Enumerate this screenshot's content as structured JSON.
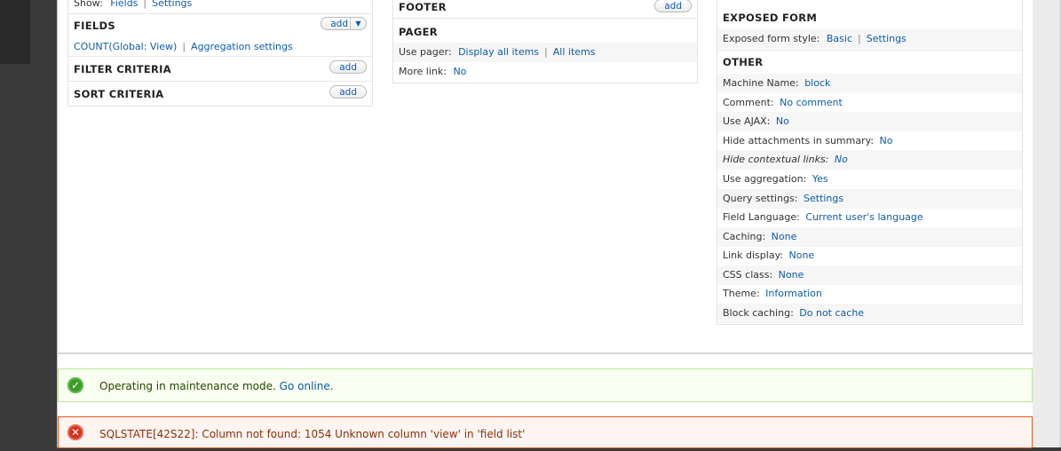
{
  "left": {
    "show_label": "Show:",
    "show_fields": "Fields",
    "show_settings": "Settings",
    "fields_heading": "FIELDS",
    "fields_add": "add",
    "field_item": "COUNT(Global: View)",
    "aggregation_settings": "Aggregation settings",
    "filter_heading": "FILTER CRITERIA",
    "filter_add": "add",
    "sort_heading": "SORT CRITERIA",
    "sort_add": "add"
  },
  "middle": {
    "footer_heading": "FOOTER",
    "footer_add": "add",
    "pager_heading": "PAGER",
    "use_pager_label": "Use pager:",
    "use_pager_value": "Display all items",
    "use_pager_extra": "All items",
    "more_link_label": "More link:",
    "more_link_value": "No"
  },
  "right": {
    "exposed_heading": "EXPOSED FORM",
    "exposed_style_label": "Exposed form style:",
    "exposed_style_value": "Basic",
    "exposed_style_settings": "Settings",
    "other_heading": "OTHER",
    "other_rows": [
      {
        "label": "Machine Name:",
        "value": "block"
      },
      {
        "label": "Comment:",
        "value": "No comment"
      },
      {
        "label": "Use AJAX:",
        "value": "No"
      },
      {
        "label": "Hide attachments in summary:",
        "value": "No"
      },
      {
        "label": "Hide contextual links:",
        "value": "No"
      },
      {
        "label": "Use aggregation:",
        "value": "Yes"
      },
      {
        "label": "Query settings:",
        "value": "Settings"
      },
      {
        "label": "Field Language:",
        "value": "Current user's language"
      },
      {
        "label": "Caching:",
        "value": "None"
      },
      {
        "label": "Link display:",
        "value": "None"
      },
      {
        "label": "CSS class:",
        "value": "None"
      },
      {
        "label": "Theme:",
        "value": "Information"
      },
      {
        "label": "Block caching:",
        "value": "Do not cache"
      }
    ]
  },
  "messages": {
    "status_text": "Operating in maintenance mode.",
    "status_link": "Go online.",
    "error_text": "SQLSTATE[42S22]: Column not found: 1054 Unknown column 'view' in 'field list'"
  },
  "colors": {
    "link": "#0d5ca8",
    "status_bg": "#f8fff0",
    "status_border": "#bee69a",
    "error_bg": "#fef5f1",
    "error_border": "#ed541d"
  },
  "icons": {
    "status": "check-circle-icon",
    "error": "x-circle-icon",
    "add_dropdown": "chevron-down-icon"
  }
}
